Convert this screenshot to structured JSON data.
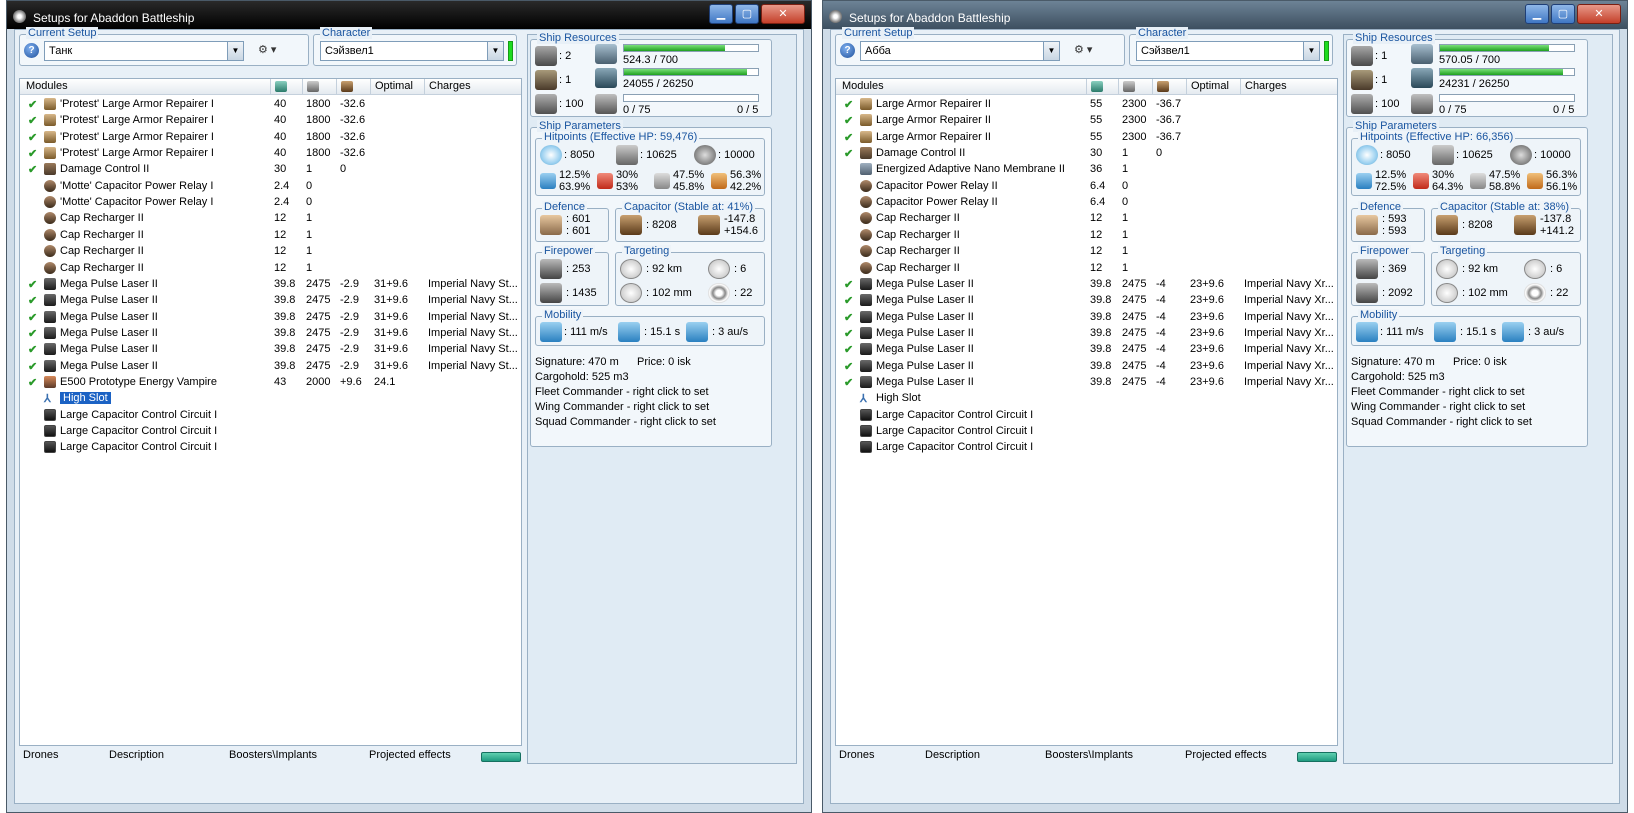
{
  "windows": [
    {
      "title": "Setups for Abaddon Battleship",
      "current_setup_label": "Current Setup",
      "setup_value": "Танк",
      "character_label": "Character",
      "character_value": "Сэйзвел1",
      "modules_header": [
        "Modules",
        "",
        "",
        "",
        "Optimal",
        "Charges"
      ],
      "modules": [
        {
          "check": "✔",
          "icon": "repairer-icon",
          "name": "'Protest' Large Armor Repairer I",
          "a": "40",
          "b": "1800",
          "c": "-32.6",
          "d": "",
          "e": ""
        },
        {
          "check": "✔",
          "icon": "repairer-icon",
          "name": "'Protest' Large Armor Repairer I",
          "a": "40",
          "b": "1800",
          "c": "-32.6",
          "d": "",
          "e": ""
        },
        {
          "check": "✔",
          "icon": "repairer-icon",
          "name": "'Protest' Large Armor Repairer I",
          "a": "40",
          "b": "1800",
          "c": "-32.6",
          "d": "",
          "e": ""
        },
        {
          "check": "✔",
          "icon": "repairer-icon",
          "name": "'Protest' Large Armor Repairer I",
          "a": "40",
          "b": "1800",
          "c": "-32.6",
          "d": "",
          "e": ""
        },
        {
          "check": "✔",
          "icon": "damage-control-icon",
          "name": "Damage Control II",
          "a": "30",
          "b": "1",
          "c": "0",
          "d": "",
          "e": ""
        },
        {
          "check": "",
          "icon": "capacitor-icon",
          "name": "'Motte' Capacitor Power Relay I",
          "a": "2.4",
          "b": "0",
          "c": "",
          "d": "",
          "e": ""
        },
        {
          "check": "",
          "icon": "capacitor-icon",
          "name": "'Motte' Capacitor Power Relay I",
          "a": "2.4",
          "b": "0",
          "c": "",
          "d": "",
          "e": ""
        },
        {
          "check": "",
          "icon": "capacitor-icon",
          "name": "Cap Recharger II",
          "a": "12",
          "b": "1",
          "c": "",
          "d": "",
          "e": ""
        },
        {
          "check": "",
          "icon": "capacitor-icon",
          "name": "Cap Recharger II",
          "a": "12",
          "b": "1",
          "c": "",
          "d": "",
          "e": ""
        },
        {
          "check": "",
          "icon": "capacitor-icon",
          "name": "Cap Recharger II",
          "a": "12",
          "b": "1",
          "c": "",
          "d": "",
          "e": ""
        },
        {
          "check": "",
          "icon": "capacitor-icon",
          "name": "Cap Recharger II",
          "a": "12",
          "b": "1",
          "c": "",
          "d": "",
          "e": ""
        },
        {
          "check": "✔",
          "icon": "laser-icon",
          "name": "Mega Pulse Laser II",
          "a": "39.8",
          "b": "2475",
          "c": "-2.9",
          "d": "31+9.6",
          "e": "Imperial Navy St..."
        },
        {
          "check": "✔",
          "icon": "laser-icon",
          "name": "Mega Pulse Laser II",
          "a": "39.8",
          "b": "2475",
          "c": "-2.9",
          "d": "31+9.6",
          "e": "Imperial Navy St..."
        },
        {
          "check": "✔",
          "icon": "laser-icon",
          "name": "Mega Pulse Laser II",
          "a": "39.8",
          "b": "2475",
          "c": "-2.9",
          "d": "31+9.6",
          "e": "Imperial Navy St..."
        },
        {
          "check": "✔",
          "icon": "laser-icon",
          "name": "Mega Pulse Laser II",
          "a": "39.8",
          "b": "2475",
          "c": "-2.9",
          "d": "31+9.6",
          "e": "Imperial Navy St..."
        },
        {
          "check": "✔",
          "icon": "laser-icon",
          "name": "Mega Pulse Laser II",
          "a": "39.8",
          "b": "2475",
          "c": "-2.9",
          "d": "31+9.6",
          "e": "Imperial Navy St..."
        },
        {
          "check": "✔",
          "icon": "laser-icon",
          "name": "Mega Pulse Laser II",
          "a": "39.8",
          "b": "2475",
          "c": "-2.9",
          "d": "31+9.6",
          "e": "Imperial Navy St..."
        },
        {
          "check": "✔",
          "icon": "vampire-icon",
          "name": "E500 Prototype Energy Vampire",
          "a": "43",
          "b": "2000",
          "c": "+9.6",
          "d": "24.1",
          "e": ""
        },
        {
          "check": "",
          "icon": "slot-icon",
          "name": "High Slot",
          "a": "",
          "b": "",
          "c": "",
          "d": "",
          "e": "",
          "selected": true
        },
        {
          "check": "",
          "icon": "rig-icon",
          "name": "Large Capacitor Control Circuit I",
          "a": "",
          "b": "",
          "c": "",
          "d": "",
          "e": ""
        },
        {
          "check": "",
          "icon": "rig-icon",
          "name": "Large Capacitor Control Circuit I",
          "a": "",
          "b": "",
          "c": "",
          "d": "",
          "e": ""
        },
        {
          "check": "",
          "icon": "rig-icon",
          "name": "Large Capacitor Control Circuit I",
          "a": "",
          "b": "",
          "c": "",
          "d": "",
          "e": ""
        }
      ],
      "bottom_tabs": [
        "Drones",
        "Description",
        "Boosters\\Implants",
        "Projected effects"
      ],
      "resources": {
        "label": "Ship Resources",
        "turrets": ": 2",
        "launchers": ": 1",
        "drones": ": 100",
        "powergrid": "524.3 / 700",
        "powergrid_fill": 0.75,
        "cpu": "24055 / 26250",
        "cpu_fill": 0.92,
        "calibration": "0 / 75",
        "calibration_fill": 0,
        "rigs": "0 / 5"
      },
      "params": {
        "label": "Ship Parameters",
        "hp_label": "Hitpoints (Effective HP: 59,476)",
        "shield": ": 8050",
        "armor": ": 10625",
        "structure": ": 10000",
        "res": [
          [
            "12.5%",
            "63.9%"
          ],
          [
            "30%",
            "53%"
          ],
          [
            "47.5%",
            "45.8%"
          ],
          [
            "56.3%",
            "42.2%"
          ]
        ],
        "defence_label": "Defence",
        "def1": ": 601",
        "def2": ": 601",
        "capacitor_label": "Capacitor (Stable at: 41%)",
        "cap": ": 8208",
        "cap1": "-147.8",
        "cap2": "+154.6",
        "firepower_label": "Firepower",
        "fp1": ": 253",
        "fp2": ": 1435",
        "targeting_label": "Targeting",
        "range": ": 92 km",
        "targets": ": 6",
        "res_scan": ": 102 mm",
        "sensor": ": 22",
        "mobility_label": "Mobility",
        "speed": ": 111 m/s",
        "align": ": 15.1 s",
        "warp": ": 3 au/s",
        "signature": "Signature: 470 m",
        "price": "Price: 0 isk",
        "cargo": "Cargohold: 525 m3",
        "fleet": "Fleet Commander - right click to set",
        "wing": "Wing Commander - right click to set",
        "squad": "Squad Commander - right click to set"
      }
    },
    {
      "title": "Setups for Abaddon Battleship",
      "current_setup_label": "Current Setup",
      "setup_value": "Абба",
      "character_label": "Character",
      "character_value": "Сэйзвел1",
      "modules_header": [
        "Modules",
        "",
        "",
        "",
        "Optimal",
        "Charges"
      ],
      "modules": [
        {
          "check": "✔",
          "icon": "repairer-icon",
          "name": "Large Armor Repairer II",
          "a": "55",
          "b": "2300",
          "c": "-36.7",
          "d": "",
          "e": ""
        },
        {
          "check": "✔",
          "icon": "repairer-icon",
          "name": "Large Armor Repairer II",
          "a": "55",
          "b": "2300",
          "c": "-36.7",
          "d": "",
          "e": ""
        },
        {
          "check": "✔",
          "icon": "repairer-icon",
          "name": "Large Armor Repairer II",
          "a": "55",
          "b": "2300",
          "c": "-36.7",
          "d": "",
          "e": ""
        },
        {
          "check": "✔",
          "icon": "damage-control-icon",
          "name": "Damage Control II",
          "a": "30",
          "b": "1",
          "c": "0",
          "d": "",
          "e": ""
        },
        {
          "check": "",
          "icon": "nano-membrane-icon",
          "name": "Energized Adaptive Nano Membrane II",
          "a": "36",
          "b": "1",
          "c": "",
          "d": "",
          "e": ""
        },
        {
          "check": "",
          "icon": "capacitor-icon",
          "name": "Capacitor Power Relay II",
          "a": "6.4",
          "b": "0",
          "c": "",
          "d": "",
          "e": ""
        },
        {
          "check": "",
          "icon": "capacitor-icon",
          "name": "Capacitor Power Relay II",
          "a": "6.4",
          "b": "0",
          "c": "",
          "d": "",
          "e": ""
        },
        {
          "check": "",
          "icon": "capacitor-icon",
          "name": "Cap Recharger II",
          "a": "12",
          "b": "1",
          "c": "",
          "d": "",
          "e": ""
        },
        {
          "check": "",
          "icon": "capacitor-icon",
          "name": "Cap Recharger II",
          "a": "12",
          "b": "1",
          "c": "",
          "d": "",
          "e": ""
        },
        {
          "check": "",
          "icon": "capacitor-icon",
          "name": "Cap Recharger II",
          "a": "12",
          "b": "1",
          "c": "",
          "d": "",
          "e": ""
        },
        {
          "check": "",
          "icon": "capacitor-icon",
          "name": "Cap Recharger II",
          "a": "12",
          "b": "1",
          "c": "",
          "d": "",
          "e": ""
        },
        {
          "check": "✔",
          "icon": "laser-icon",
          "name": "Mega Pulse Laser II",
          "a": "39.8",
          "b": "2475",
          "c": "-4",
          "d": "23+9.6",
          "e": "Imperial Navy Xr..."
        },
        {
          "check": "✔",
          "icon": "laser-icon",
          "name": "Mega Pulse Laser II",
          "a": "39.8",
          "b": "2475",
          "c": "-4",
          "d": "23+9.6",
          "e": "Imperial Navy Xr..."
        },
        {
          "check": "✔",
          "icon": "laser-icon",
          "name": "Mega Pulse Laser II",
          "a": "39.8",
          "b": "2475",
          "c": "-4",
          "d": "23+9.6",
          "e": "Imperial Navy Xr..."
        },
        {
          "check": "✔",
          "icon": "laser-icon",
          "name": "Mega Pulse Laser II",
          "a": "39.8",
          "b": "2475",
          "c": "-4",
          "d": "23+9.6",
          "e": "Imperial Navy Xr..."
        },
        {
          "check": "✔",
          "icon": "laser-icon",
          "name": "Mega Pulse Laser II",
          "a": "39.8",
          "b": "2475",
          "c": "-4",
          "d": "23+9.6",
          "e": "Imperial Navy Xr..."
        },
        {
          "check": "✔",
          "icon": "laser-icon",
          "name": "Mega Pulse Laser II",
          "a": "39.8",
          "b": "2475",
          "c": "-4",
          "d": "23+9.6",
          "e": "Imperial Navy Xr..."
        },
        {
          "check": "✔",
          "icon": "laser-icon",
          "name": "Mega Pulse Laser II",
          "a": "39.8",
          "b": "2475",
          "c": "-4",
          "d": "23+9.6",
          "e": "Imperial Navy Xr..."
        },
        {
          "check": "",
          "icon": "slot-icon",
          "name": "High Slot",
          "a": "",
          "b": "",
          "c": "",
          "d": "",
          "e": ""
        },
        {
          "check": "",
          "icon": "rig-icon",
          "name": "Large Capacitor Control Circuit I",
          "a": "",
          "b": "",
          "c": "",
          "d": "",
          "e": ""
        },
        {
          "check": "",
          "icon": "rig-icon",
          "name": "Large Capacitor Control Circuit I",
          "a": "",
          "b": "",
          "c": "",
          "d": "",
          "e": ""
        },
        {
          "check": "",
          "icon": "rig-icon",
          "name": "Large Capacitor Control Circuit I",
          "a": "",
          "b": "",
          "c": "",
          "d": "",
          "e": ""
        }
      ],
      "bottom_tabs": [
        "Drones",
        "Description",
        "Boosters\\Implants",
        "Projected effects"
      ],
      "resources": {
        "label": "Ship Resources",
        "turrets": ": 1",
        "launchers": ": 1",
        "drones": ": 100",
        "powergrid": "570.05 / 700",
        "powergrid_fill": 0.81,
        "cpu": "24231 / 26250",
        "cpu_fill": 0.92,
        "calibration": "0 / 75",
        "calibration_fill": 0,
        "rigs": "0 / 5"
      },
      "params": {
        "label": "Ship Parameters",
        "hp_label": "Hitpoints (Effective HP: 66,356)",
        "shield": ": 8050",
        "armor": ": 10625",
        "structure": ": 10000",
        "res": [
          [
            "12.5%",
            "72.5%"
          ],
          [
            "30%",
            "64.3%"
          ],
          [
            "47.5%",
            "58.8%"
          ],
          [
            "56.3%",
            "56.1%"
          ]
        ],
        "defence_label": "Defence",
        "def1": ": 593",
        "def2": ": 593",
        "capacitor_label": "Capacitor (Stable at: 38%)",
        "cap": ": 8208",
        "cap1": "-137.8",
        "cap2": "+141.2",
        "firepower_label": "Firepower",
        "fp1": ": 369",
        "fp2": ": 2092",
        "targeting_label": "Targeting",
        "range": ": 92 km",
        "targets": ": 6",
        "res_scan": ": 102 mm",
        "sensor": ": 22",
        "mobility_label": "Mobility",
        "speed": ": 111 m/s",
        "align": ": 15.1 s",
        "warp": ": 3 au/s",
        "signature": "Signature: 470 m",
        "price": "Price: 0 isk",
        "cargo": "Cargohold: 525 m3",
        "fleet": "Fleet Commander - right click to set",
        "wing": "Wing Commander - right click to set",
        "squad": "Squad Commander - right click to set"
      }
    }
  ]
}
